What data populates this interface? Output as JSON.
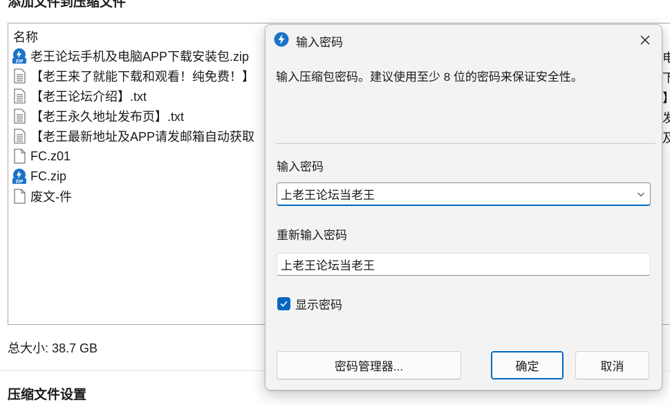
{
  "background_window": {
    "title": "添加文件到压缩文件",
    "column_header": "名称",
    "files": [
      {
        "name": "老王论坛手机及电脑APP下载安装包.zip",
        "icon": "zip-icon"
      },
      {
        "name": "【老王来了就能下载和观看！纯免费！】",
        "icon": "text-file-icon"
      },
      {
        "name": "【老王论坛介绍】.txt",
        "icon": "text-file-icon"
      },
      {
        "name": "【老王永久地址发布页】.txt",
        "icon": "text-file-icon"
      },
      {
        "name": "【老王最新地址及APP请发邮箱自动获取",
        "icon": "text-file-icon"
      },
      {
        "name": "FC.z01",
        "icon": "blank-file-icon"
      },
      {
        "name": "FC.zip",
        "icon": "zip-icon"
      },
      {
        "name": "废文-件",
        "icon": "blank-file-icon"
      }
    ],
    "right_edge_fragments": [
      "电",
      "下",
      "】",
      "发",
      "及"
    ],
    "total_size": "总大小: 38.7 GB",
    "settings_title": "压缩文件设置"
  },
  "dialog": {
    "title": "输入密码",
    "description": "输入压缩包密码。建议使用至少 8 位的密码来保证安全性。",
    "password_label": "输入密码",
    "password_value": "上老王论坛当老王",
    "reenter_label": "重新输入密码",
    "reenter_value": "上老王论坛当老王",
    "show_password_label": "显示密码",
    "show_password_checked": true,
    "buttons": {
      "manager": "密码管理器...",
      "ok": "确定",
      "cancel": "取消"
    }
  },
  "colors": {
    "accent": "#0067c0",
    "zip_icon_blue": "#1a73c9"
  }
}
